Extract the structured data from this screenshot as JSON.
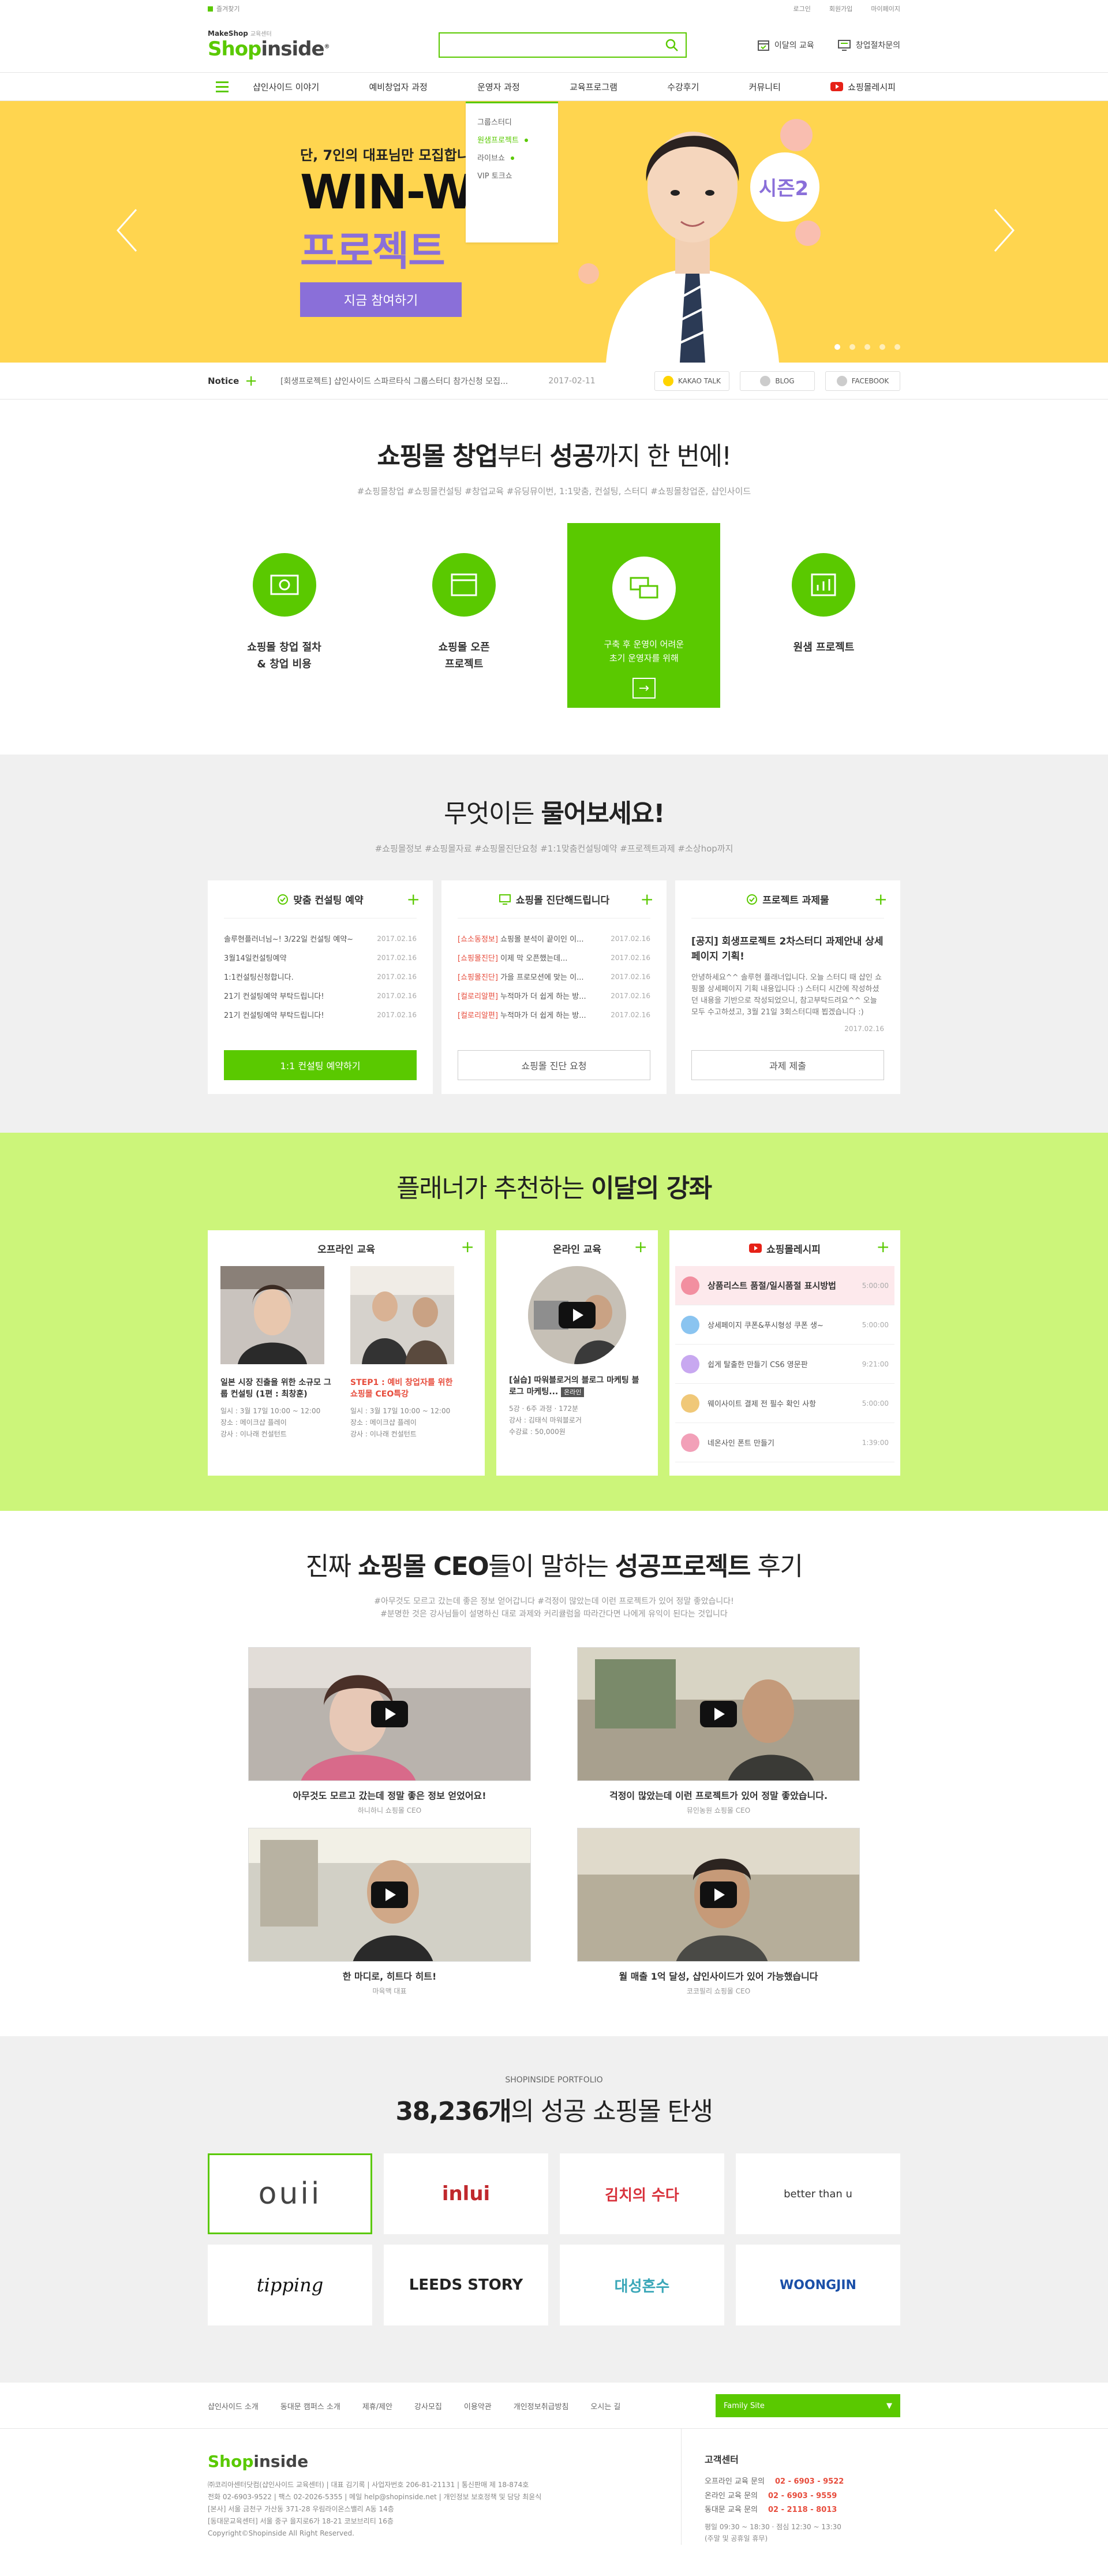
{
  "topbar": {
    "fav": "즐겨찾기",
    "links": [
      "로그인",
      "회원가입",
      "마이페이지"
    ]
  },
  "header": {
    "logo_small": "MakeShop",
    "logo_small2": "교육센터",
    "logo_green": "Shop",
    "logo_dark": "inside",
    "search_placeholder": "",
    "link1": "이달의 교육",
    "link2": "창업절차문의"
  },
  "gnb": {
    "items": [
      "샵인사이드 이야기",
      "예비창업자 과정",
      "운영자 과정",
      "교육프로그램",
      "수강후기",
      "커뮤니티",
      "쇼핑몰레시피"
    ],
    "dropdown": [
      "그룹스터디",
      "원샘프로젝트",
      "라이브쇼",
      "VIP 토크쇼"
    ]
  },
  "hero": {
    "sub": "단, 7인의 대표님만 모집합니다",
    "title": "WIN-WIN",
    "title2": "프로젝트",
    "season": "시즌2",
    "button": "지금 참여하기"
  },
  "notice": {
    "label": "Notice",
    "text": "[회생프로젝트] 샵인사이드 스파르타식 그룹스터디 참가신청 모집...",
    "date": "2017-02-11",
    "social": [
      "KAKAO TALK",
      "BLOG",
      "FACEBOOK"
    ]
  },
  "sec1": {
    "title_a": "쇼핑몰 창업",
    "title_b": "부터 ",
    "title_c": "성공",
    "title_d": "까지 한 번에!",
    "tags": "#쇼핑몰창업 #쇼핑몰컨설팅 #창업교육 #유딩뮤이번, 1:1맞춤, 컨설팅, 스터디 #쇼핑몰창업준, 샵인사이드",
    "cards": [
      {
        "l1": "쇼핑몰 창업 절차",
        "l2": "& 창업 비용"
      },
      {
        "l1": "쇼핑몰 오픈",
        "l2": "프로젝트"
      },
      {
        "l1": "구축 후 운영이 어려운",
        "l2": "초기 운영자를 위해"
      },
      {
        "l1": "원샘 프로젝트",
        "l2": ""
      }
    ]
  },
  "sec2": {
    "title_a": "무엇이든 ",
    "title_b": "물어보세요!",
    "tags": "#쇼핑몰정보 #쇼핑몰자료 #쇼핑몰진단요청 #1:1맞춤컨설팅예약 #프로젝트과제 #소상hop까지",
    "box1": {
      "title": "맞춤 컨설팅 예약",
      "rows": [
        {
          "t": "솔루현플러너님~! 3/22일 컨설팅 예약~",
          "d": "2017.02.16"
        },
        {
          "t": "3월14일컨설팅예약",
          "d": "2017.02.16"
        },
        {
          "t": "1:1컨설팅신청합니다.",
          "d": "2017.02.16"
        },
        {
          "t": "21기 컨설팅예약 부탁드립니다!",
          "d": "2017.02.16"
        },
        {
          "t": "21기 컨설팅예약 부탁드립니다!",
          "d": "2017.02.16"
        }
      ],
      "button": "1:1 컨설팅 예약하기"
    },
    "box2": {
      "title": "쇼핑몰 진단해드립니다",
      "rows": [
        {
          "h": "[쇼소동정보]",
          "t": " 쇼핑몰 분석이 끝이인 이...",
          "d": "2017.02.16"
        },
        {
          "h": "[쇼핑몰진단]",
          "t": " 이제 막 오픈했는데...",
          "d": "2017.02.16"
        },
        {
          "h": "[쇼핑몰진단]",
          "t": " 가을 프로모션에 맞는 이...",
          "d": "2017.02.16"
        },
        {
          "h": "[컬로리알편]",
          "t": " 누적마가 더 쉽게 하는 방...",
          "d": "2017.02.16"
        },
        {
          "h": "[컬로리알편]",
          "t": " 누적마가 더 쉽게 하는 방...",
          "d": "2017.02.16"
        }
      ],
      "button": "쇼핑몰 진단 요청"
    },
    "box3": {
      "title": "프로젝트 과제물",
      "post_title": "[공지] 회생프로젝트 2차스터디 과제안내 상세페이지 기획!",
      "post_body": "안녕하세요^^ 솔루현 플래너입니다. 오늘 스터디 때 샵인 쇼핑몰 상세페이지 기획 내용입니다 :) 스터디 시간에 작성하셨던 내용을 기반으로 작성되었으니, 참고부탁드려요^^ 오늘 모두 수고하셨고, 3월 21일 3회스터디때 뵙겠습니다 :)",
      "post_date": "2017.02.16",
      "button": "과제 제출"
    }
  },
  "sec3": {
    "title_a": "플래너가 추천하는 ",
    "title_b": "이달의 강좌",
    "offline": {
      "title": "오프라인 교육",
      "items": [
        {
          "cap": "일본 시장 진출을 위한 소규모 그룹 컨설팅 (1편 : 최창훈)",
          "m1": "일시 : 3월 17일 10:00 ~ 12:00",
          "m2": "장소 : 메이크샵 플레이",
          "m3": "강사 : 이나래 컨설턴트"
        },
        {
          "cap": "STEP1 : 예비 창업자를 위한 쇼핑몰 CEO특강",
          "m1": "일시 : 3월 17일 10:00 ~ 12:00",
          "m2": "장소 : 메이크샵 플레이",
          "m3": "강사 : 이나래 컨설턴트"
        }
      ]
    },
    "online": {
      "title": "온라인 교육",
      "cap": "[실습] 따워블로거의 블로그 마케팅 블로그 마케팅...",
      "badge": "온라인",
      "m1": "5강 · 6주 과정 · 172분",
      "m2": "강사 : 김태식 마워블로거",
      "m3": "수강료 : 50,000원"
    },
    "youtube": {
      "title": "쇼핑몰레시피",
      "rows": [
        {
          "t": "상품리스트 품절/일시품절 표시방법",
          "tm": "5:00:00"
        },
        {
          "t": "상세페이지 쿠폰&푸시형성 쿠폰 생~",
          "tm": "5:00:00"
        },
        {
          "t": "쉽게 탈출한 만들기 CS6 영문판",
          "tm": "9:21:00"
        },
        {
          "t": "웨이사이트 결제 전 필수 확인 사항",
          "tm": "5:00:00"
        },
        {
          "t": "네온사인 폰트 만들기",
          "tm": "1:39:00"
        }
      ]
    }
  },
  "sec4": {
    "title_a": "진짜 ",
    "title_b": "쇼핑몰 CEO",
    "title_c": "들이 말하는 ",
    "title_d": "성공프로젝트",
    "title_e": " 후기",
    "tags1": "#아무것도 모르고 갔는데 좋은 정보 얻어갑니다 #걱정이 많았는데 이런 프로젝트가 있어 정말 좋았습니다!",
    "tags2": "#분명한 것은 강사님들이 설명하신 대로 과제와 커리큘럼을 따라간다면 나에게 유익이 된다는 것입니다",
    "videos": [
      {
        "t": "아무것도 모르고 갔는데 정말 좋은 정보 얻었어요!",
        "s": "하니하니 쇼핑몰 CEO"
      },
      {
        "t": "걱정이 많았는데 이런 프로젝트가 있어 정말 좋았습니다.",
        "s": "뮤인농원 쇼핑몰 CEO"
      },
      {
        "t": "한 마디로, 히트다 히트!",
        "s": "마육맥 대표"
      },
      {
        "t": "월 매출 1억 달성, 샵인사이드가 있어 가능했습니다",
        "s": "코코필리 쇼핑몰 CEO"
      }
    ]
  },
  "sec5": {
    "tag": "SHOPINSIDE PORTFOLIO",
    "title_a": "38,236개",
    "title_b": "의 성공 쇼핑몰 탄생",
    "logos": [
      "ouii",
      "inlui",
      "김치의 수다",
      "better than u",
      "tipping",
      "LEEDS STORY",
      "대성혼수",
      "WOONGJIN"
    ]
  },
  "footer": {
    "nav": [
      "샵인사이드 소개",
      "동대문 캠퍼스 소개",
      "제휴/제안",
      "강사모집",
      "이용약관",
      "개인정보취급방침",
      "오시는 길"
    ],
    "family": "Family Site",
    "logo_green": "Shop",
    "logo_dark": "inside",
    "lines": [
      "㈜코리아센터닷컴(샵인사이드 교육센터) | 대표 김기록 | 사업자번호 206-81-21131 | 통신판매 제 18-874호",
      "전화 02-6903-9522 | 팩스 02-2026-5355 | 메일 help@shopinside.net | 개인정보 보호정책 및 담당 최윤식",
      "[본사] 서울 금천구 가산동 371-28 우림라이온스밸리 A동 14층",
      "[동대문교육센터] 서울 중구 을지로6가 18-21 코보브리티 16층",
      "Copyright©Shopinside All Right Reserved."
    ],
    "cs_title": "고객센터",
    "cs": [
      {
        "k": "오프라인 교육 문의",
        "v": "02 - 6903 - 9522"
      },
      {
        "k": "온라인 교육 문의",
        "v": "02 - 6903 - 9559"
      },
      {
        "k": "동대문 교육 문의",
        "v": "02 - 2118 - 8013"
      }
    ],
    "hours": "평일 09:30 ~ 18:30 · 점심 12:30 ~ 13:30",
    "hours2": "(주말 및 공휴일 휴무)"
  },
  "colors": {
    "brand": "#5ac900",
    "hero": "#ffd54f",
    "accent": "#8a6fd9",
    "lime": "#ccf57a"
  }
}
